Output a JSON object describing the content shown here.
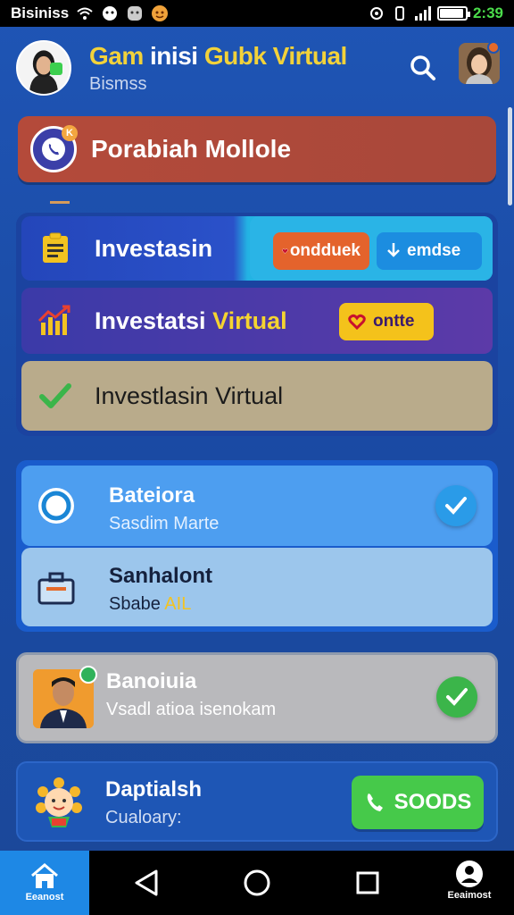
{
  "status_bar": {
    "app_name": "Bisiniss",
    "time": "2:39"
  },
  "header": {
    "title_part1": "Gam",
    "title_part2": "inisi",
    "title_part3": "Gubk Virtual",
    "subtitle": "Bismss"
  },
  "banner": {
    "badge": "K",
    "title": "Porabiah Mollole"
  },
  "invest": {
    "row1_label": "Investasin",
    "row1_pill_orange": "ondduek",
    "row1_pill_blue": "emdse",
    "row2_label_part1": "Investatsi",
    "row2_label_part2": "Virtual",
    "row2_pill_yellow": "ontte",
    "row3_label": "Investlasin Virtual"
  },
  "cards": {
    "card1_title": "Bateiora",
    "card1_sub": "Sasdim Marte",
    "card2_title": "Sanhalont",
    "card2_sub": "Sbabe",
    "card2_sub_highlight": "AIL",
    "card3_title": "Banoiuia",
    "card3_sub": "Vsadl atioa isenokam",
    "card4_title": "Daptialsh",
    "card4_sub": "Cualoary:",
    "card4_button": "SOODS"
  },
  "nav": {
    "home_label": "Eeanost",
    "profile_label": "Eeaimost"
  },
  "colors": {
    "accent_yellow": "#f2d23a",
    "banner_red": "#b44a3a",
    "check_green": "#3bb54a",
    "check_blue": "#2a9be8"
  },
  "icons": {
    "wifi": "wifi-icon",
    "search": "search-icon",
    "home": "home-icon",
    "back": "back-triangle-icon",
    "recent": "recent-square-icon",
    "person": "person-icon"
  }
}
